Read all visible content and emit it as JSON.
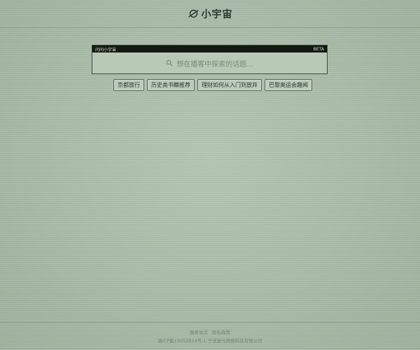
{
  "header": {
    "title": "小宇宙"
  },
  "search": {
    "bar_left": "问问小宇宙",
    "bar_right": "BETA",
    "placeholder": "想在播客中探索的话题..."
  },
  "suggestions": [
    "京都旅行",
    "历史类书籍推荐",
    "理财如何从入门到放弃",
    "巴黎奥运会趣闻"
  ],
  "footer": {
    "links": [
      "服务协议",
      "隐私政策"
    ],
    "icp": "浙ICP备19052624号-1 宁波宙光网络科技有限公司"
  }
}
